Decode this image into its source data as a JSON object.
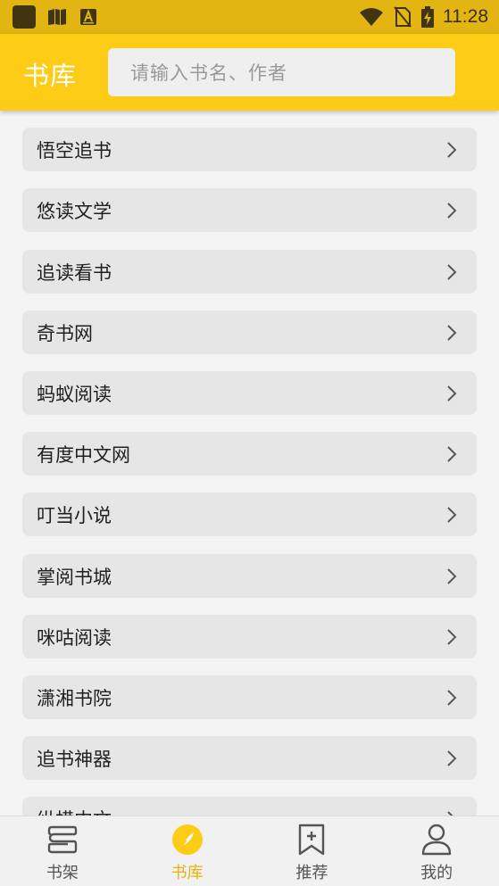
{
  "status_bar": {
    "time": "11:28",
    "icons": [
      "app-square-icon",
      "book-notification-icon",
      "a-notification-icon",
      "wifi-icon",
      "no-sim-icon",
      "battery-charging-icon"
    ]
  },
  "header": {
    "title": "书库",
    "search_placeholder": "请输入书名、作者"
  },
  "sources": [
    {
      "label": "悟空追书"
    },
    {
      "label": "悠读文学"
    },
    {
      "label": "追读看书"
    },
    {
      "label": "奇书网"
    },
    {
      "label": "蚂蚁阅读"
    },
    {
      "label": "有度中文网"
    },
    {
      "label": "叮当小说"
    },
    {
      "label": "掌阅书城"
    },
    {
      "label": "咪咕阅读"
    },
    {
      "label": "潇湘书院"
    },
    {
      "label": "追书神器"
    },
    {
      "label": "纵横中文"
    }
  ],
  "bottom_nav": [
    {
      "label": "书架",
      "icon": "bookshelf-icon",
      "active": false
    },
    {
      "label": "书库",
      "icon": "compass-icon",
      "active": true
    },
    {
      "label": "推荐",
      "icon": "bookmark-plus-icon",
      "active": false
    },
    {
      "label": "我的",
      "icon": "person-icon",
      "active": false
    }
  ],
  "colors": {
    "accent": "#fccc16",
    "status_bar": "#e2b512",
    "active_nav": "#e7b20f"
  }
}
